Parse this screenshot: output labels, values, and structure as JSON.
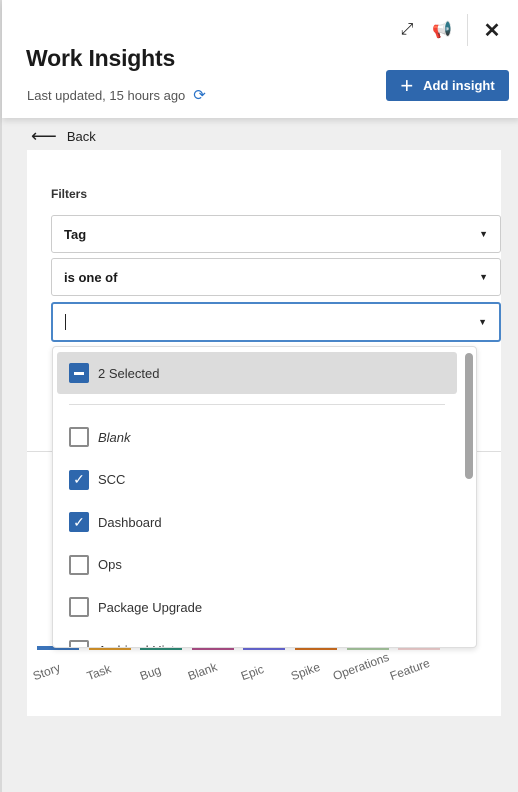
{
  "header": {
    "title": "Work Insights",
    "last_updated": "Last updated, 15 hours ago",
    "add_label": "Add insight"
  },
  "nav": {
    "back_label": "Back"
  },
  "filters": {
    "label": "Filters",
    "field": "Tag",
    "operator": "is one of",
    "value": ""
  },
  "dropdown": {
    "summary": "2 Selected",
    "options": [
      {
        "label": "Blank",
        "checked": false,
        "italic": true
      },
      {
        "label": "SCC",
        "checked": true
      },
      {
        "label": "Dashboard",
        "checked": true
      },
      {
        "label": "Ops",
        "checked": false
      },
      {
        "label": "Package Upgrade",
        "checked": false
      },
      {
        "label": "Archived History",
        "checked": false
      }
    ]
  },
  "chart_data": {
    "type": "bar",
    "categories": [
      "Story",
      "Task",
      "Bug",
      "Blank",
      "Epic",
      "Spike",
      "Operations",
      "Feature"
    ],
    "colors": [
      "#3b73b9",
      "#d9962b",
      "#2e8b78",
      "#b0508a",
      "#6a6ad8",
      "#d07020",
      "#a8c8a0",
      "#f0d0d0"
    ]
  }
}
